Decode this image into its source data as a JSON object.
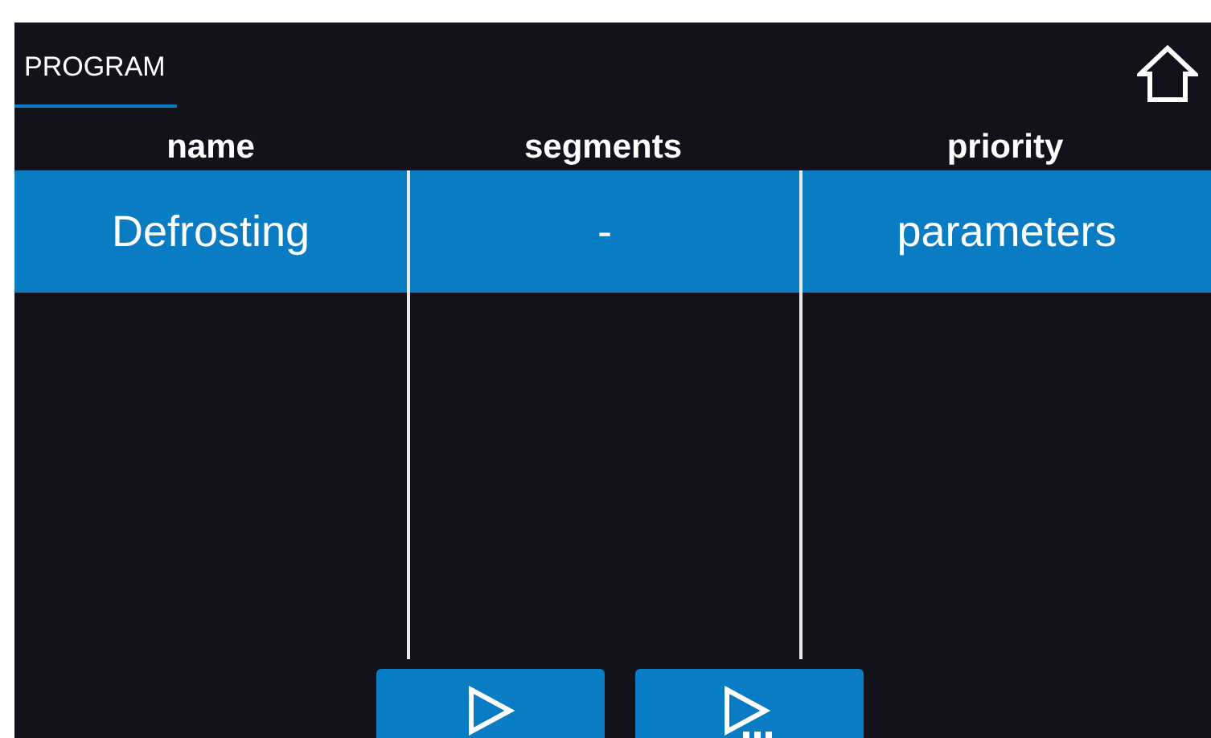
{
  "tabs": [
    {
      "label": "PROGRAM",
      "selected": true
    }
  ],
  "table": {
    "columns": [
      "name",
      "segments",
      "priority"
    ],
    "rows": [
      {
        "cells": [
          "Defrosting",
          "-",
          "parameters"
        ],
        "selected": true
      }
    ]
  },
  "buttons": [
    {
      "kind": "start"
    },
    {
      "kind": "start-options"
    }
  ]
}
